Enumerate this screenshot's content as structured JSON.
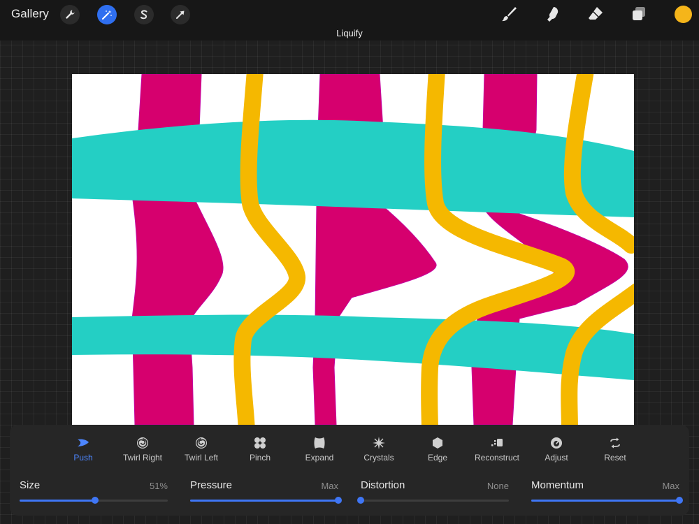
{
  "topbar": {
    "gallery_label": "Gallery",
    "mode_title": "Liquify",
    "current_color": "#f5b51a"
  },
  "liquify_tools": [
    {
      "label": "Push",
      "icon": "push-icon",
      "active": true
    },
    {
      "label": "Twirl Right",
      "icon": "twirl-right-icon"
    },
    {
      "label": "Twirl Left",
      "icon": "twirl-left-icon"
    },
    {
      "label": "Pinch",
      "icon": "pinch-icon"
    },
    {
      "label": "Expand",
      "icon": "expand-icon"
    },
    {
      "label": "Crystals",
      "icon": "crystals-icon"
    },
    {
      "label": "Edge",
      "icon": "edge-icon"
    },
    {
      "label": "Reconstruct",
      "icon": "reconstruct-icon"
    },
    {
      "label": "Adjust",
      "icon": "adjust-icon"
    },
    {
      "label": "Reset",
      "icon": "reset-icon"
    }
  ],
  "sliders": [
    {
      "name": "Size",
      "value_text": "51%",
      "level": 0.51
    },
    {
      "name": "Pressure",
      "value_text": "Max",
      "level": 1.0
    },
    {
      "name": "Distortion",
      "value_text": "None",
      "level": 0.0
    },
    {
      "name": "Momentum",
      "value_text": "Max",
      "level": 1.0
    }
  ],
  "colors": {
    "magenta": "#d6006e",
    "teal": "#24cfc4",
    "yellow": "#f5b800",
    "accent": "#3f76f5"
  }
}
